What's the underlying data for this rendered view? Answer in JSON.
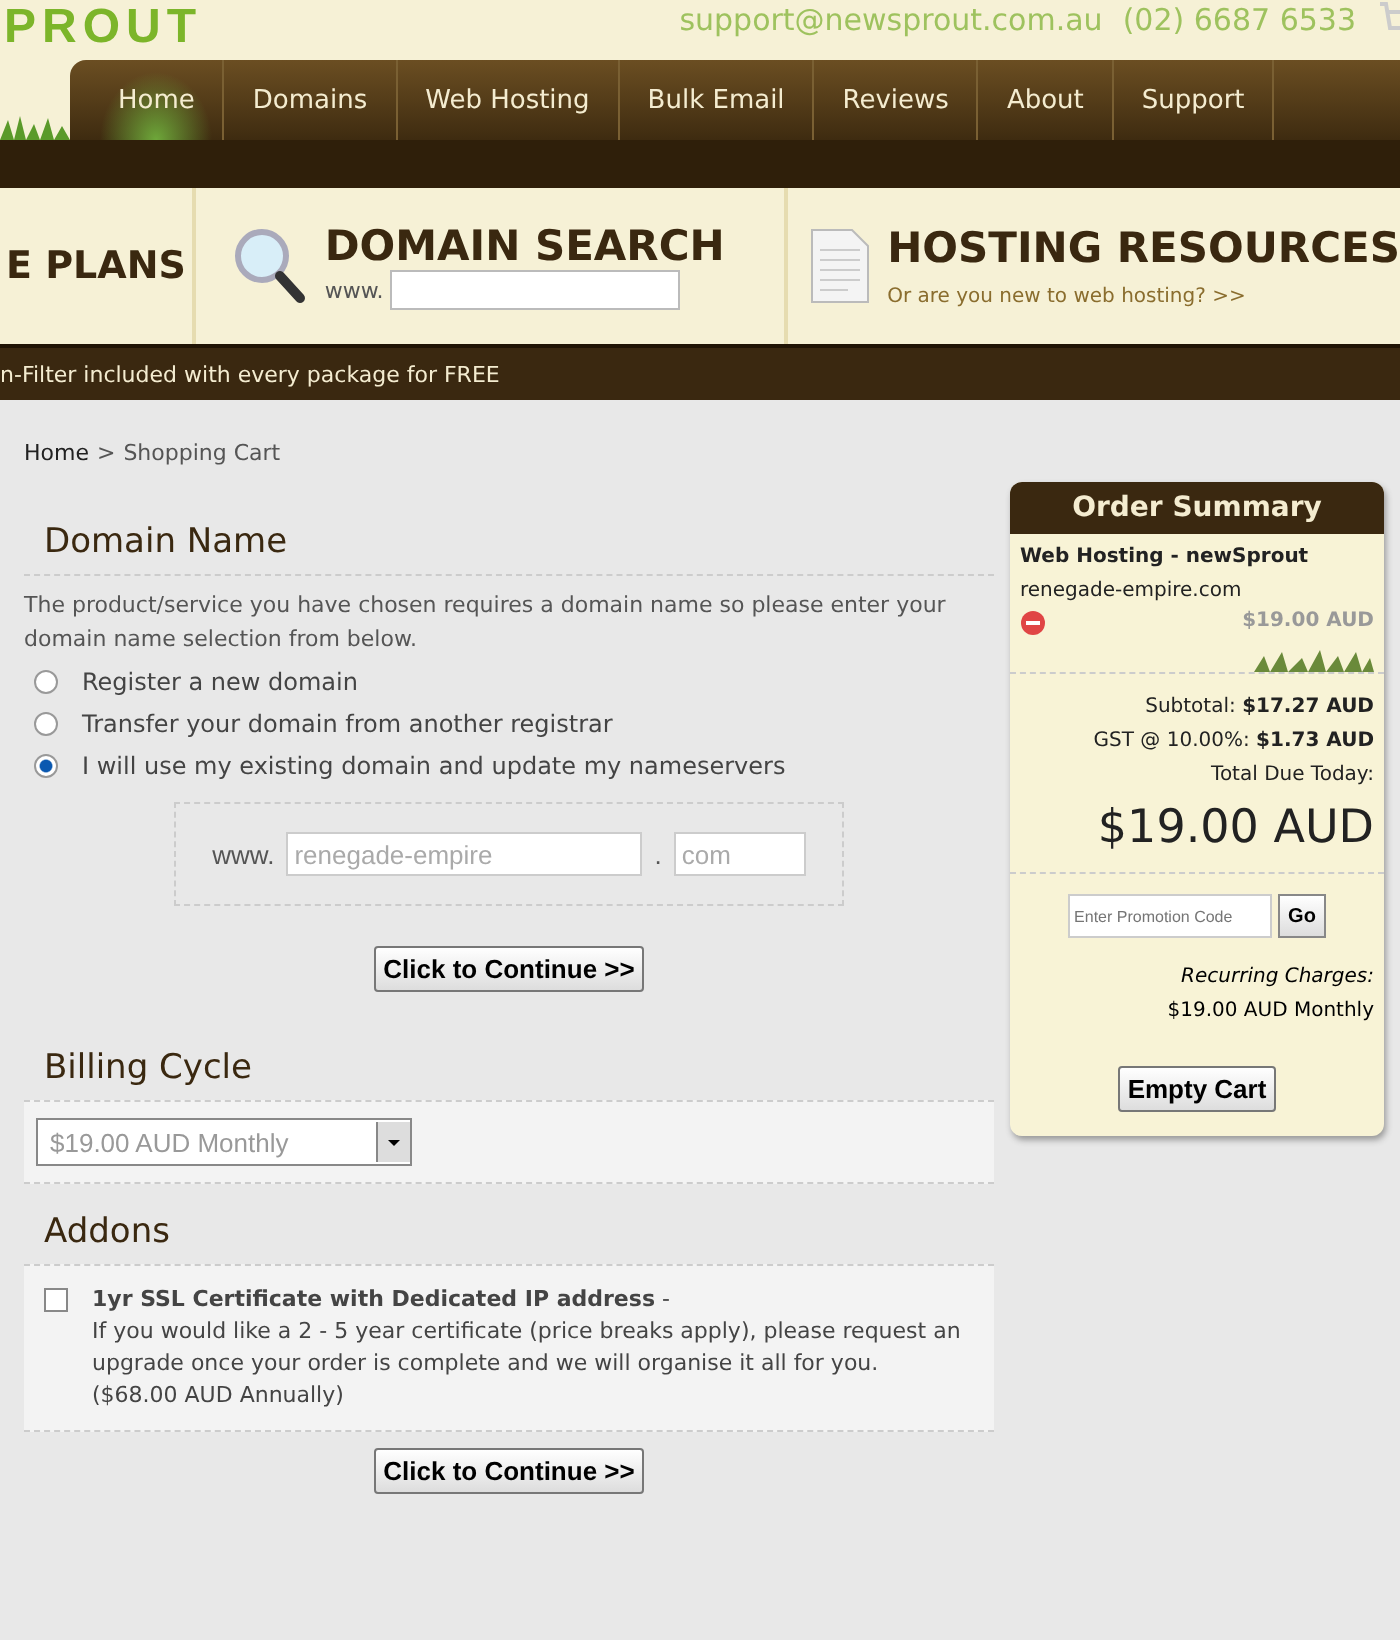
{
  "header": {
    "logo": "PROUT",
    "email": "support@newsprout.com.au",
    "phone": "(02) 6687 6533"
  },
  "nav": [
    {
      "label": "Home",
      "selected": true
    },
    {
      "label": "Domains",
      "selected": false
    },
    {
      "label": "Web Hosting",
      "selected": false
    },
    {
      "label": "Bulk Email",
      "selected": false
    },
    {
      "label": "Reviews",
      "selected": false
    },
    {
      "label": "About",
      "selected": false
    },
    {
      "label": "Support",
      "selected": false
    }
  ],
  "features": {
    "plans_title": "E PLANS",
    "domain_search": {
      "title": "DOMAIN SEARCH",
      "prefix": "www."
    },
    "resources": {
      "title": "HOSTING RESOURCES",
      "link": "Or are you new to web hosting? >>"
    }
  },
  "ticker": "n-Filter included with every package for FREE",
  "breadcrumb": {
    "home": "Home",
    "separator": ">",
    "current": "Shopping Cart"
  },
  "domain": {
    "title": "Domain Name",
    "intro": "The product/service you have chosen requires a domain name so please enter your domain name selection from below.",
    "options": [
      {
        "label": "Register a new domain",
        "selected": false
      },
      {
        "label": "Transfer your domain from another registrar",
        "selected": false
      },
      {
        "label": "I will use my existing domain and update my nameservers",
        "selected": true
      }
    ],
    "prefix": "www.",
    "name": "renegade-empire",
    "dot": ".",
    "tld": "com",
    "button": "Click to Continue >>"
  },
  "billing": {
    "title": "Billing Cycle",
    "value": "$19.00 AUD Monthly"
  },
  "addons": {
    "title": "Addons",
    "items": [
      {
        "name": "1yr SSL Certificate with Dedicated IP address",
        "dash": "-",
        "description": "If you would like a 2 - 5 year certificate (price breaks apply), please request an upgrade once your order is complete and we will organise it all for you.",
        "price": "($68.00 AUD Annually)",
        "checked": false
      }
    ],
    "button": "Click to Continue >>"
  },
  "summary": {
    "title": "Order Summary",
    "product": "Web Hosting - newSprout",
    "domain": "renegade-empire.com",
    "price": "$19.00 AUD",
    "subtotal_label": "Subtotal:",
    "subtotal": "$17.27 AUD",
    "gst_label": "GST @ 10.00%:",
    "gst": "$1.73 AUD",
    "total_label": "Total Due Today:",
    "total": "$19.00 AUD",
    "promo_placeholder": "Enter Promotion Code",
    "go": "Go",
    "recurring_label": "Recurring Charges:",
    "recurring": "$19.00 AUD Monthly",
    "empty": "Empty Cart"
  }
}
